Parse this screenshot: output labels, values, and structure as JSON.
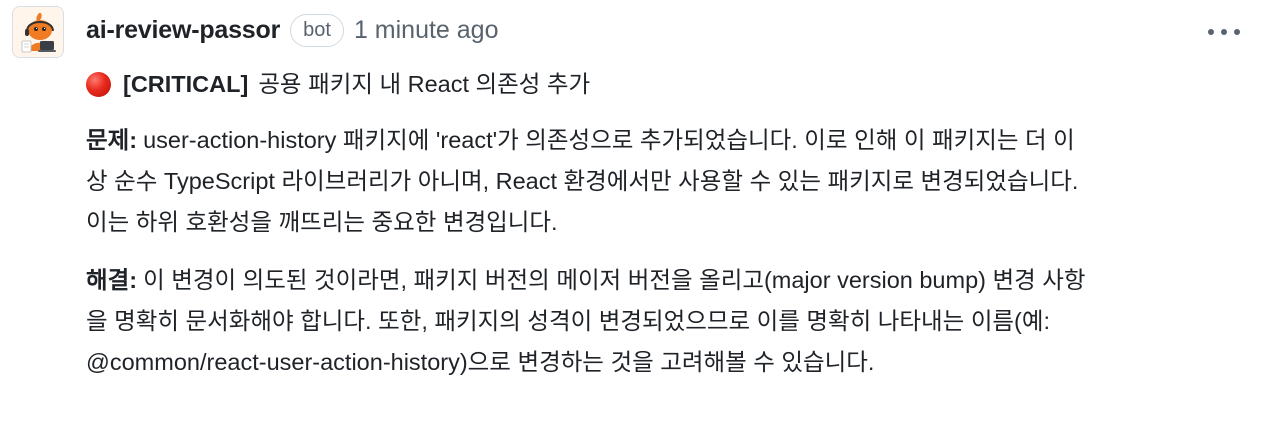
{
  "comment": {
    "author": "ai-review-passor",
    "badge": "bot",
    "timestamp": "1 minute ago",
    "more_icon": "kebab-horizontal-icon",
    "avatar_icon": "bot-mascot-avatar"
  },
  "review": {
    "title_icon": "red-circle-icon",
    "title_tag": "[CRITICAL]",
    "title_text": "공용 패키지 내 React 의존성 추가",
    "problem_label": "문제:",
    "problem_lines": [
      "user-action-history 패키지에 'react'가 의존성으로 추가되었습니다. 이로 인해 이 패키지는 더 이",
      "상 순수 TypeScript 라이브러리가 아니며, React 환경에서만 사용할 수 있는 패키지로 변경되었습니다.",
      "이는 하위 호환성을 깨뜨리는 중요한 변경입니다."
    ],
    "solution_label": "해결:",
    "solution_lines": [
      "이 변경이 의도된 것이라면, 패키지 버전의 메이저 버전을 올리고(major version bump) 변경 사항",
      "을 명확히 문서화해야 합니다. 또한, 패키지의 성격이 변경되었으므로 이를 명확히 나타내는 이름(예:",
      "@common/react-user-action-history)으로 변경하는 것을 고려해볼 수 있습니다."
    ]
  },
  "colors": {
    "text": "#1f2328",
    "muted": "#59636e",
    "border": "#d1d9e0",
    "critical": "#e8281c",
    "avatar_orange": "#f07b22"
  }
}
